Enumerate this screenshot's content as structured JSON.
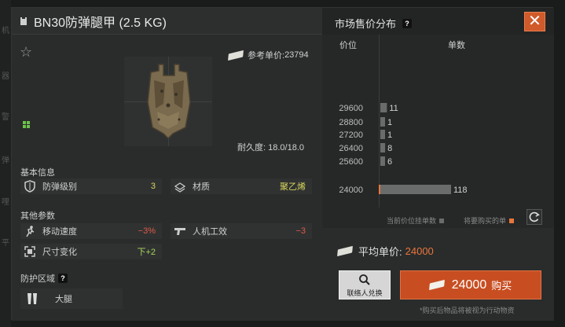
{
  "background_hints": [
    "机",
    "器",
    "警",
    "弹",
    "哩",
    "平"
  ],
  "title": {
    "text": "BN30防弹腿甲 (2.5 KG)"
  },
  "reference_price": {
    "label": "参考单价:",
    "value": "23794"
  },
  "durability": {
    "label": "耐久度:",
    "value": "18.0/18.0"
  },
  "basic_info": {
    "label": "基本信息",
    "protection_level": {
      "label": "防弹级别",
      "value": "3"
    },
    "material": {
      "label": "材质",
      "value": "聚乙烯"
    }
  },
  "other_params": {
    "label": "其他参数",
    "move_speed": {
      "label": "移动速度",
      "value": "−3%"
    },
    "ergonomics": {
      "label": "人机工效",
      "value": "−3"
    },
    "size_change": {
      "label": "尺寸变化",
      "value": "下+2"
    }
  },
  "protection_zone": {
    "label": "防护区域",
    "help": "?",
    "zone": "大腿"
  },
  "market": {
    "title": "市场售价分布",
    "help": "?",
    "close": "✕",
    "col_price": "价位",
    "col_count": "单数",
    "legend_listed": "当前价位挂单数",
    "legend_mine": "将要购买的单",
    "legend_listed_color": "#6a6c6c",
    "legend_mine_color": "#e8763a"
  },
  "chart_data": {
    "type": "bar",
    "orientation": "horizontal",
    "categories": [
      "29600",
      "28800",
      "27200",
      "26400",
      "25600",
      "24000"
    ],
    "values": [
      11,
      1,
      1,
      8,
      6,
      118
    ],
    "value_labels": [
      "11",
      "1",
      "1",
      "8",
      "6",
      "118"
    ],
    "highlight_category": "24000",
    "xlabel": "单数",
    "ylabel": "价位"
  },
  "average_price": {
    "label": "平均单价:",
    "value": "24000"
  },
  "exchange_button": {
    "label": "联络人兑换"
  },
  "buy_button": {
    "price": "24000",
    "label": "购买"
  },
  "note": "*购买后物品将被视为行动物资"
}
